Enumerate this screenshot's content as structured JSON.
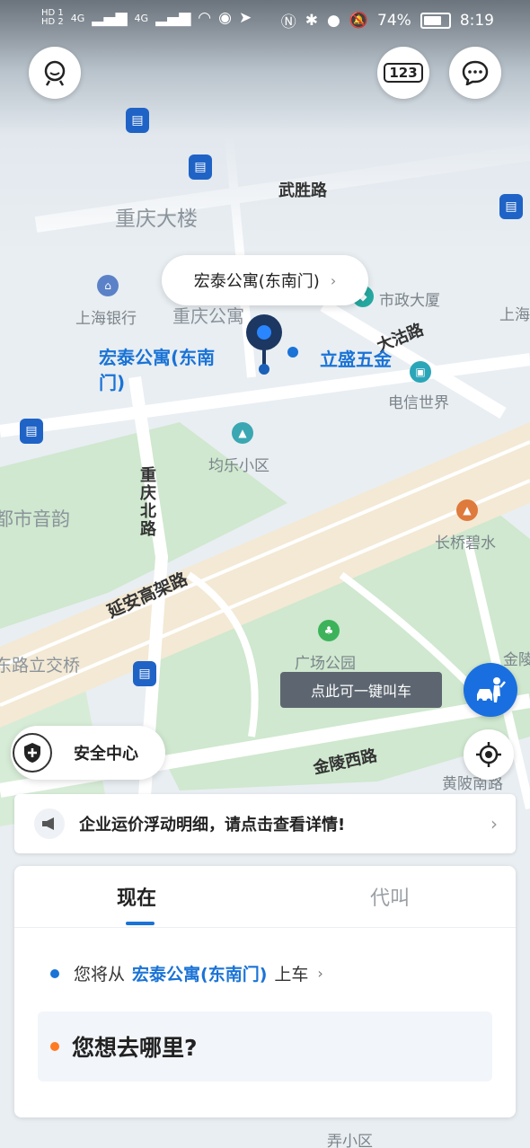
{
  "status_bar": {
    "sim1": "HD 1",
    "sim2": "HD 2",
    "signal": "4G",
    "battery": "74%",
    "time": "8:19"
  },
  "top_bar": {
    "profile_icon": "avatar-face-icon",
    "plate_badge": "123",
    "message_icon": "chat-bubble-icon"
  },
  "map": {
    "labels": {
      "road_wushenglu": "武胜路",
      "area_chongqing_building": "重庆大楼",
      "poi_shanghai_bank": "上海银行",
      "poi_shizheng": "市政大厦",
      "road_dagulu": "大沽路",
      "poi_lisheng": "立盛五金",
      "poi_dianxin": "电信世界",
      "poi_junle": "均乐小区",
      "road_chongqing_north": "重庆北路",
      "area_yinyue": "都市音韵",
      "poi_changqiao": "长桥碧水",
      "road_yanan": "延安高架路",
      "poi_guangchang": "广场公园",
      "area_donglu": "东路立交桥",
      "road_jinling": "金陵西路",
      "road_huangpi": "黄陂南路",
      "pickup_map_label": "宏泰公寓(东南门)",
      "area_chongqing_gongyu": "重庆公寓",
      "area_shanghai_edge": "上海",
      "area_jinhe": "金陵",
      "poi_nong": "弄小区"
    },
    "pickup_callout": "宏泰公寓(东南门)",
    "one_key_tooltip": "点此可一键叫车",
    "safety_center": "安全中心"
  },
  "notice": {
    "text": "企业运价浮动明细，请点击查看详情!"
  },
  "booking": {
    "tabs": [
      "现在",
      "代叫"
    ],
    "pickup_prefix": "您将从",
    "pickup_place": "宏泰公寓(东南门)",
    "pickup_suffix": "上车",
    "destination_prompt": "您想去哪里?"
  },
  "colors": {
    "accent": "#1a73d6",
    "destination_dot": "#ff7a22",
    "pin": "#1c3761"
  }
}
